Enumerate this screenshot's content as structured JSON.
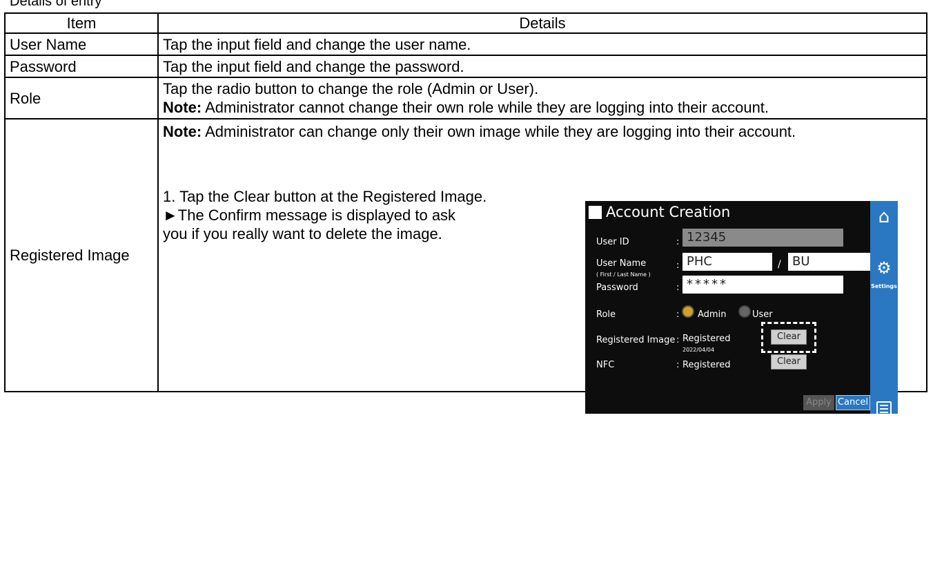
{
  "caption": "Details of entry",
  "table": {
    "headers": [
      "Item",
      "Details"
    ],
    "rows": [
      {
        "item": "User Name",
        "details": "Tap the input field and change the user name."
      },
      {
        "item": "Password",
        "details": "Tap the input field and change the password."
      },
      {
        "item": "Role",
        "details": "Tap the radio button to change the role (Admin or User).",
        "note_label": "Note:",
        "note_text": " Administrator cannot change their own role while they are logging into their account."
      },
      {
        "item": "Registered Image",
        "note_label": "Note:",
        "note_text": " Administrator can change only their own image while they are logging into their account.",
        "step1": "1. Tap the Clear button at the Registered Image.",
        "step1_result": "►The Confirm message is displayed to ask",
        "step1_result_cont": "you if you really want to delete the image."
      }
    ]
  },
  "screenshot": {
    "title": "Account Creation",
    "user_id_label": "User ID",
    "user_id_value": "12345",
    "user_name_label": "User Name",
    "user_name_sub": "( First / Last Name )",
    "first_name": "PHC",
    "last_name": "BU",
    "name_separator": "/",
    "password_label": "Password",
    "password_value": "*****",
    "role_label": "Role",
    "role_admin": "Admin",
    "role_user": "User",
    "role_selected": "Admin",
    "reg_image_label": "Registered Image",
    "reg_image_status": "Registered",
    "reg_image_date": "2022/04/04",
    "nfc_label": "NFC",
    "nfc_status": "Registered",
    "colon": ":",
    "clear_label": "Clear",
    "apply_label": "Apply",
    "cancel_label": "Cancel",
    "settings_label": "Settings",
    "icons": [
      "home-icon",
      "gear-icon",
      "list-icon",
      "chart-icon",
      "table-icon"
    ],
    "rail_color": "#2a78c2"
  }
}
